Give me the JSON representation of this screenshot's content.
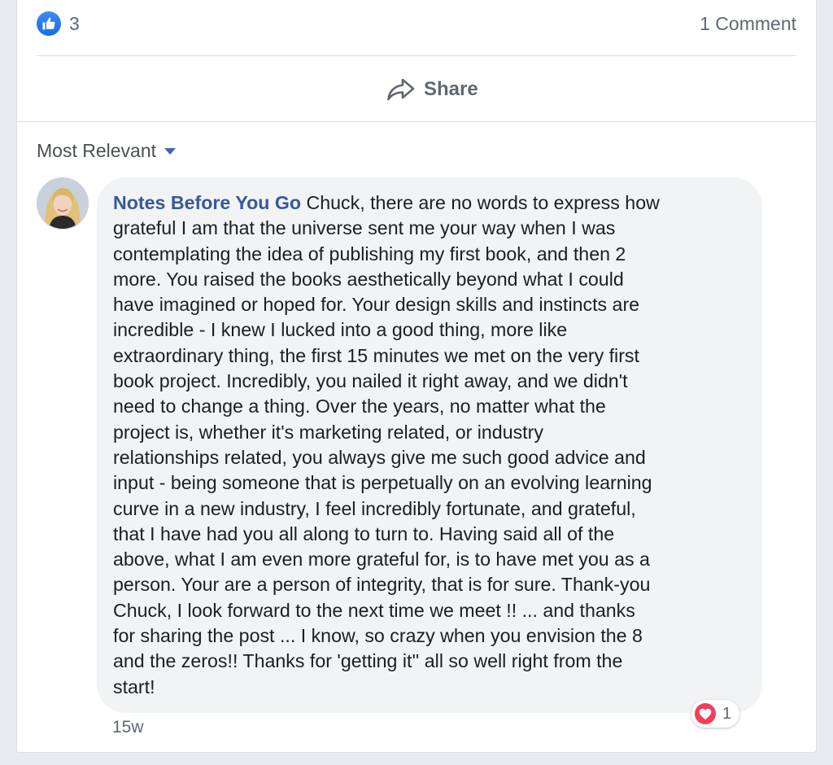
{
  "reactions": {
    "count": "3",
    "icon": "like-thumb-icon",
    "color": "#1877f2"
  },
  "comments": {
    "count_label": "1 Comment"
  },
  "actions": {
    "share_label": "Share",
    "share_icon": "share-arrow-icon"
  },
  "sort": {
    "label": "Most Relevant",
    "icon": "caret-down-icon"
  },
  "comment": {
    "author": "Notes Before You Go",
    "text": " Chuck, there are no words to express how\ngrateful I am that the universe sent me your way when I was\ncontemplating the idea of publishing my first book, and then 2\nmore. You raised the books aesthetically beyond what I could\nhave imagined or hoped for. Your design skills and instincts are\nincredible - I knew I lucked into a good thing, more like\nextraordinary thing, the first 15 minutes we met on the very first\nbook project. Incredibly, you nailed it right away, and we didn't\nneed to change a thing. Over the years, no matter what the\nproject is, whether it's marketing related, or industry\nrelationships related, you always give me such good advice and\ninput - being someone that is perpetually on an evolving learning\ncurve in a new industry, I feel incredibly fortunate, and grateful,\nthat I have had you all along to turn to. Having said all of the\nabove, what I am even more grateful for, is to have met you as a\nperson. Your are a person of integrity, that is for sure. Thank-you\nChuck, I look forward to the next time we meet !! ... and thanks\nfor sharing the post ... I know, so crazy when you envision the 8\nand the zeros!! Thanks for 'getting it'' all so well right from the\nstart!",
    "timestamp": "15w",
    "reaction_count": "1",
    "reaction_icon": "love-heart-icon",
    "reaction_color": "#f33e58",
    "author_color": "#385898"
  }
}
